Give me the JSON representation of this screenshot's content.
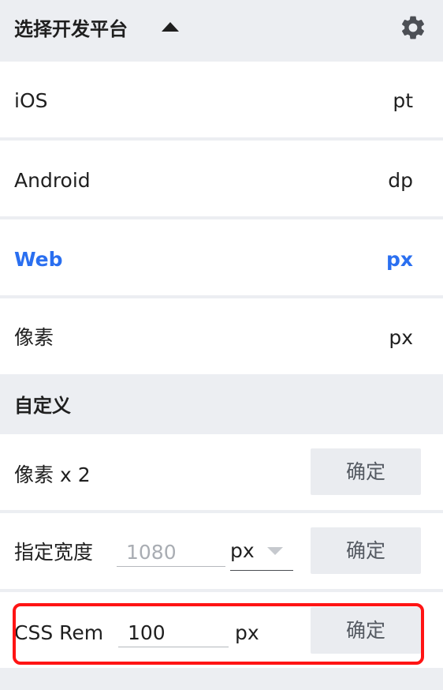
{
  "header": {
    "title": "选择开发平台",
    "collapse_icon": "caret-up-icon",
    "settings_icon": "gear-icon"
  },
  "platforms": [
    {
      "name": "iOS",
      "unit": "pt",
      "selected": false
    },
    {
      "name": "Android",
      "unit": "dp",
      "selected": false
    },
    {
      "name": "Web",
      "unit": "px",
      "selected": true
    },
    {
      "name": "像素",
      "unit": "px",
      "selected": false
    }
  ],
  "custom": {
    "title": "自定义",
    "pixel_x2": {
      "label": "像素 x 2",
      "button_label": "确定"
    },
    "width": {
      "label": "指定宽度",
      "value": "",
      "placeholder": "1080",
      "unit_selected": "px",
      "button_label": "确定"
    },
    "css_rem": {
      "label": "CSS Rem",
      "value": "100",
      "unit": "px",
      "button_label": "确定"
    }
  },
  "colors": {
    "selected": "#2a6ff0",
    "highlight": "#ff1414",
    "background": "#eceef2"
  }
}
